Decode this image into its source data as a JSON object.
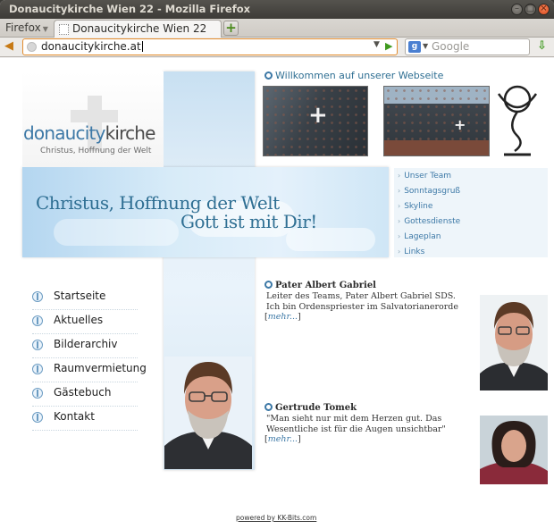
{
  "window": {
    "title": "Donaucitykirche Wien 22 - Mozilla Firefox",
    "controls": {
      "minimize": "–",
      "maximize": "□",
      "close": "×"
    }
  },
  "tabs": {
    "menu_label": "Firefox",
    "active_tab": "Donaucitykirche Wien 22",
    "new_tab_symbol": "+"
  },
  "navbar": {
    "back_symbol": "◀",
    "url": "donaucitykirche.at",
    "go_symbol": "▶",
    "search_engine": "g",
    "search_placeholder": "Google",
    "download_symbol": "⇩"
  },
  "site": {
    "logo": {
      "word_part1": "donaucity",
      "word_part2": "kirche",
      "tagline": "Christus, Hoffnung der Welt"
    },
    "slogan": {
      "line1": "Christus, Hoffnung der Welt",
      "line2": "Gott ist mit Dir!"
    },
    "welcome": "Willkommen auf unserer Webseite",
    "right_nav": [
      {
        "label": "Unser Team"
      },
      {
        "label": "Sonntagsgruß"
      },
      {
        "label": "Skyline"
      },
      {
        "label": "Gottesdienste"
      },
      {
        "label": "Lageplan"
      },
      {
        "label": "Links"
      }
    ],
    "left_nav": [
      {
        "label": "Startseite"
      },
      {
        "label": "Aktuelles"
      },
      {
        "label": "Bilderarchiv"
      },
      {
        "label": "Raumvermietung"
      },
      {
        "label": "Gästebuch"
      },
      {
        "label": "Kontakt"
      }
    ],
    "articles": [
      {
        "title": "Pater Albert Gabriel",
        "text": "Leiter des Teams, Pater Albert Gabriel SDS. Ich bin Ordenspriester im Salvatorianerorde",
        "more_open": "[",
        "more": "mehr...",
        "more_close": "]"
      },
      {
        "title": "Gertrude Tomek",
        "text": "\"Man sieht nur mit dem Herzen gut. Das Wesentliche ist für die Augen unsichtbar\"",
        "more_open": "[",
        "more": "mehr...",
        "more_close": "]"
      }
    ],
    "footer": "powered by KK-Bits.com"
  }
}
